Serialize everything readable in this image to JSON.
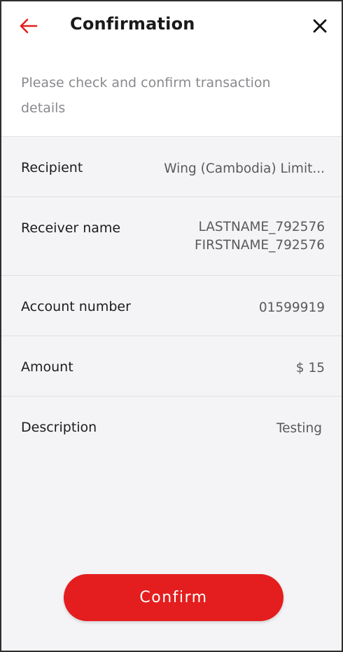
{
  "header": {
    "title": "Confirmation",
    "back_icon": "arrow-left-icon",
    "close_icon": "close-icon"
  },
  "subtitle": "Please check and confirm transaction details",
  "details": [
    {
      "label": "Recipient",
      "value": "Wing (Cambodia) Limit..."
    },
    {
      "label": "Receiver name",
      "value_line1": "LASTNAME_792576",
      "value_line2": "FIRSTNAME_792576"
    },
    {
      "label": "Account number",
      "value": "01599919"
    },
    {
      "label": "Amount",
      "value": "$ 15"
    },
    {
      "label": "Description",
      "value": "Testing"
    }
  ],
  "confirm_button": {
    "label": "Confirm"
  },
  "colors": {
    "accent": "#e41e1e",
    "background": "#f4f4f6",
    "header_bg": "#ffffff",
    "label_text": "#1c1c1e",
    "value_text": "#5a5a5e",
    "subtitle_text": "#8a8a8e"
  }
}
